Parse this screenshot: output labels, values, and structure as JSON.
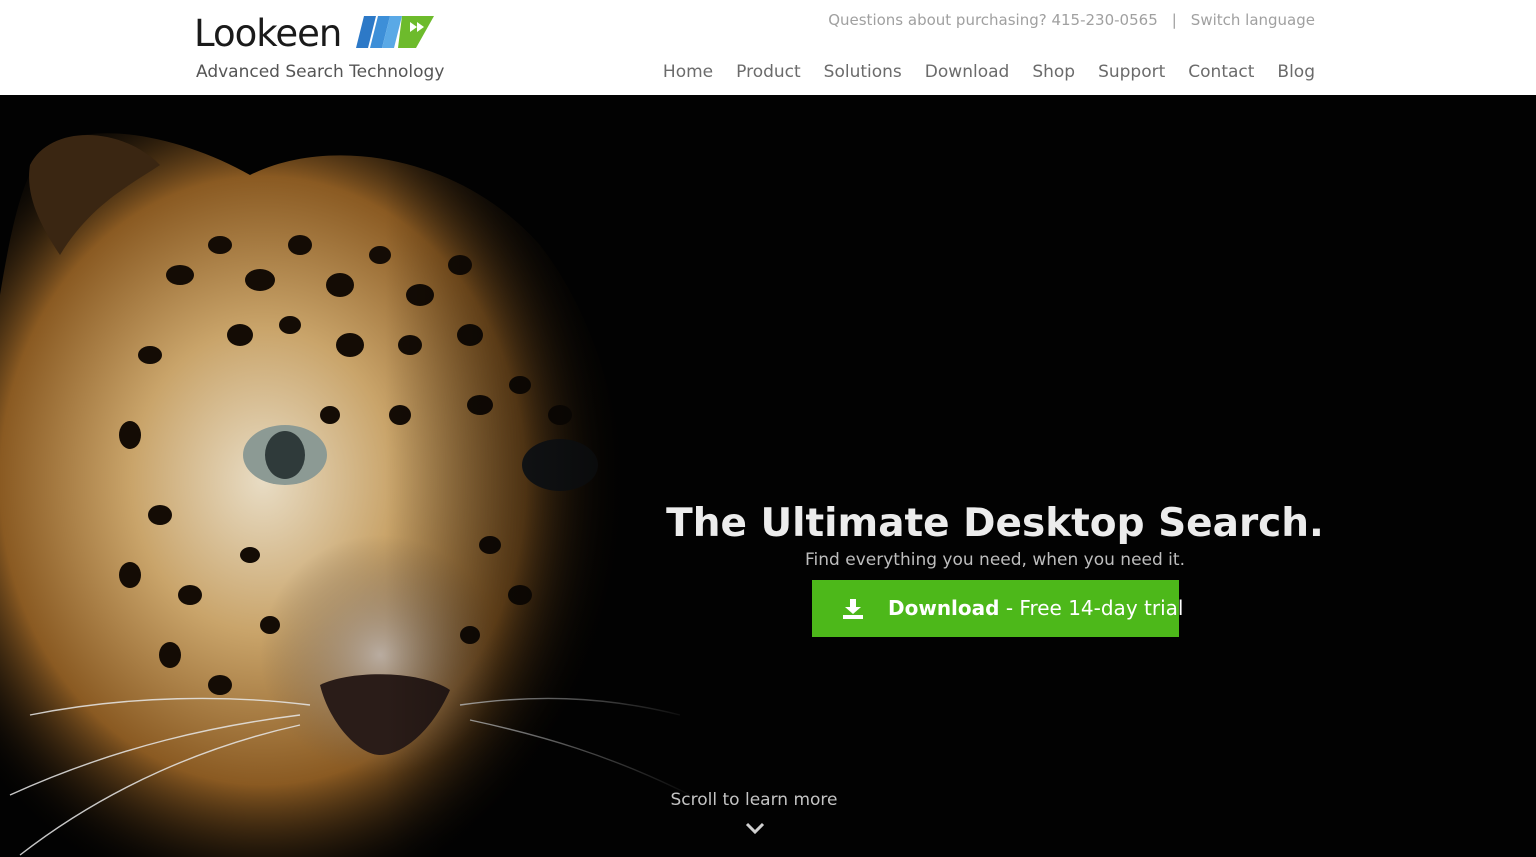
{
  "header": {
    "logo": {
      "name": "Lookeen",
      "tagline": "Advanced Search Technology",
      "colors": {
        "blue": "#2d79c7",
        "green": "#6dbb2c"
      }
    },
    "topbar": {
      "purchase_text": "Questions about purchasing? 415-230-0565",
      "separator": "|",
      "switch_language": "Switch language"
    },
    "nav": [
      {
        "label": "Home"
      },
      {
        "label": "Product"
      },
      {
        "label": "Solutions"
      },
      {
        "label": "Download"
      },
      {
        "label": "Shop"
      },
      {
        "label": "Support"
      },
      {
        "label": "Contact"
      },
      {
        "label": "Blog"
      }
    ]
  },
  "hero": {
    "image": "leopard-face",
    "title": "The Ultimate Desktop Search.",
    "subtitle": "Find everything you need, when you need it.",
    "cta": {
      "icon": "download-icon",
      "strong_label": "Download",
      "rest_label": " - Free 14-day trial",
      "color": "#4db81a"
    },
    "scroll_label": "Scroll to learn more",
    "scroll_icon": "chevron-down-icon"
  }
}
